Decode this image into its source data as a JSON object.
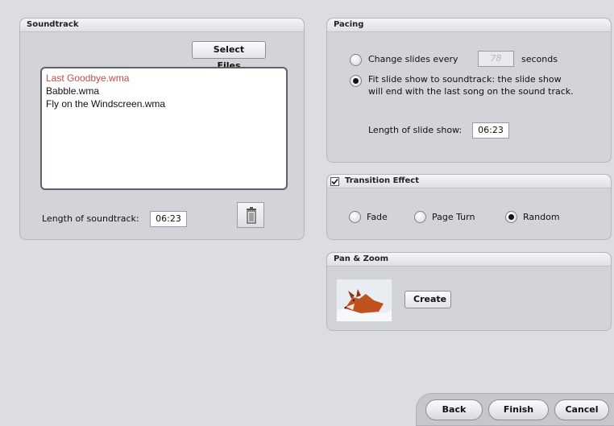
{
  "soundtrack": {
    "title": "Soundtrack",
    "select_files_label": "Select Files",
    "files": [
      {
        "name": "Last Goodbye.wma",
        "color": "#c84a4a"
      },
      {
        "name": "Babble.wma",
        "color": "#111111"
      },
      {
        "name": "Fly on the Windscreen.wma",
        "color": "#111111"
      }
    ],
    "length_label": "Length of soundtrack:",
    "length_value": "06:23",
    "delete_icon": "trash-icon"
  },
  "pacing": {
    "title": "Pacing",
    "option1_label": "Change slides every",
    "option1_value": "78",
    "option1_unit": "seconds",
    "option1_selected": false,
    "option2_line1": "Fit slide show to soundtrack: the slide show",
    "option2_line2": "will end with the last song on the sound track.",
    "option2_selected": true,
    "length_label": "Length of slide show:",
    "length_value": "06:23"
  },
  "transition": {
    "title": "Transition Effect",
    "enabled": true,
    "options": [
      {
        "label": "Fade",
        "selected": false
      },
      {
        "label": "Page Turn",
        "selected": false
      },
      {
        "label": "Random",
        "selected": true
      }
    ]
  },
  "panzoom": {
    "title": "Pan & Zoom",
    "thumbnail_icon": "fox-thumbnail",
    "create_label": "Create"
  },
  "nav": {
    "back_label": "Back",
    "finish_label": "Finish",
    "cancel_label": "Cancel"
  }
}
